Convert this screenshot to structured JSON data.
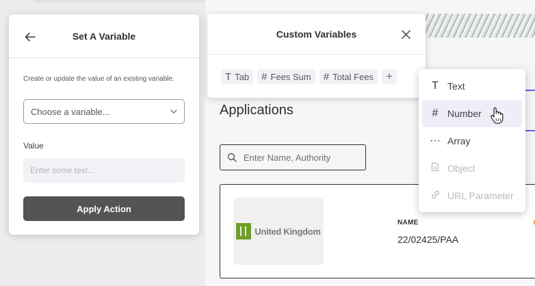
{
  "set_variable_panel": {
    "title": "Set A Variable",
    "description": "Create or update the value of an existing variable.",
    "select_placeholder": "Choose a variable...",
    "value_label": "Value",
    "value_placeholder": "Enter some text...",
    "apply_label": "Apply Action"
  },
  "custom_variables_panel": {
    "title": "Custom Variables",
    "chips": [
      {
        "icon": "text-type-icon",
        "glyph": "T",
        "label": "Tab"
      },
      {
        "icon": "hash-icon",
        "glyph": "#",
        "label": "Fees Sum"
      },
      {
        "icon": "hash-icon",
        "glyph": "#",
        "label": "Total Fees"
      }
    ],
    "add_glyph": "+"
  },
  "type_dropdown": {
    "options": [
      {
        "label": "Text",
        "icon": "text-type-icon",
        "glyph": "T",
        "state": "enabled"
      },
      {
        "label": "Number",
        "icon": "hash-icon",
        "glyph": "#",
        "state": "highlighted"
      },
      {
        "label": "Array",
        "icon": "ellipsis-icon",
        "glyph": "···",
        "state": "enabled"
      },
      {
        "label": "Object",
        "icon": "document-icon",
        "glyph": "",
        "state": "disabled"
      },
      {
        "label": "URL Parameter",
        "icon": "link-icon",
        "glyph": "",
        "state": "disabled"
      }
    ]
  },
  "background_app": {
    "heading": "Applications",
    "search_placeholder": "Enter Name, Authority",
    "card": {
      "logo_text": "United Kingdom",
      "name_label": "NAME",
      "name_value": "22/02425/PAA"
    }
  },
  "colors": {
    "accent": "#6d5ce7",
    "apply_button": "#545457",
    "logo_green": "#6f9f2a",
    "highlight": "#efeef8"
  }
}
